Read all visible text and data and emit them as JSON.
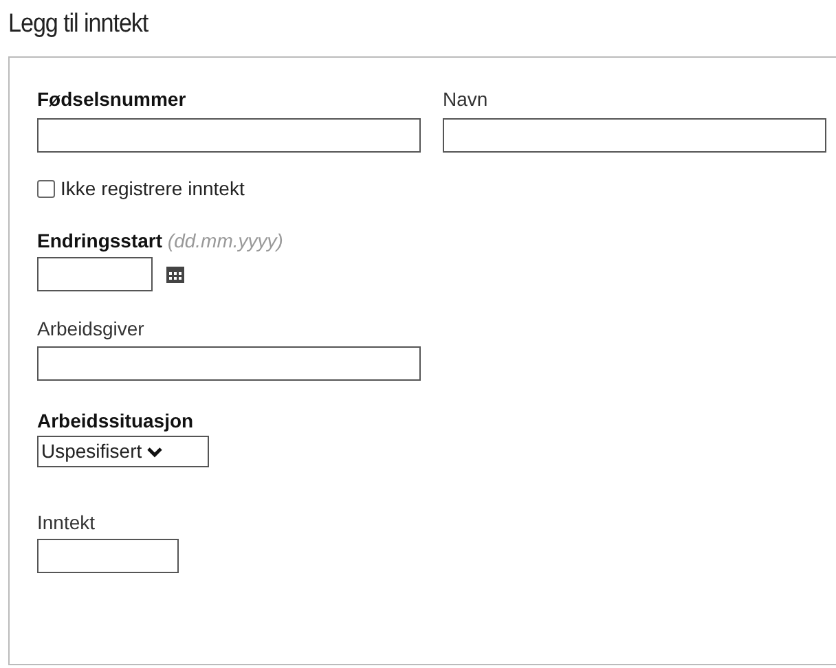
{
  "title": "Legg til inntekt",
  "top_fields": [
    {
      "label": "Fødselsnummer",
      "required": true
    },
    {
      "label": "Navn",
      "required": false
    }
  ],
  "checkbox": {
    "label": "Ikke registrere inntekt",
    "checked": false
  },
  "date_field": {
    "label": "Endringsstart",
    "required": true,
    "hint": "(dd.mm.yyyy)"
  },
  "employer_field": {
    "label": "Arbeidsgiver",
    "required": false
  },
  "situation_field": {
    "label": "Arbeidssituasjon",
    "required": true,
    "value": "Uspesifisert"
  },
  "income_field": {
    "label": "Inntekt",
    "required": false
  }
}
